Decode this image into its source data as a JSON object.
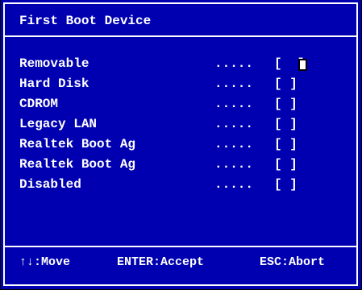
{
  "dialog": {
    "title": "First Boot Device",
    "options": [
      {
        "label": "Removable",
        "dots": ".....",
        "bracket": "[  ]",
        "selected": true
      },
      {
        "label": "Hard Disk",
        "dots": ".....",
        "bracket": "[ ]",
        "selected": false
      },
      {
        "label": "CDROM",
        "dots": ".....",
        "bracket": "[ ]",
        "selected": false
      },
      {
        "label": "Legacy LAN",
        "dots": ".....",
        "bracket": "[ ]",
        "selected": false
      },
      {
        "label": "Realtek Boot Ag",
        "dots": ".....",
        "bracket": "[ ]",
        "selected": false
      },
      {
        "label": "Realtek Boot Ag",
        "dots": ".....",
        "bracket": "[ ]",
        "selected": false
      },
      {
        "label": "Disabled",
        "dots": ".....",
        "bracket": "[ ]",
        "selected": false
      }
    ]
  },
  "footer": {
    "move": "↑↓:Move",
    "accept": "ENTER:Accept",
    "abort": "ESC:Abort"
  },
  "colors": {
    "background": "#0000b0",
    "text": "#ffffff",
    "frame": "#ffffff"
  }
}
